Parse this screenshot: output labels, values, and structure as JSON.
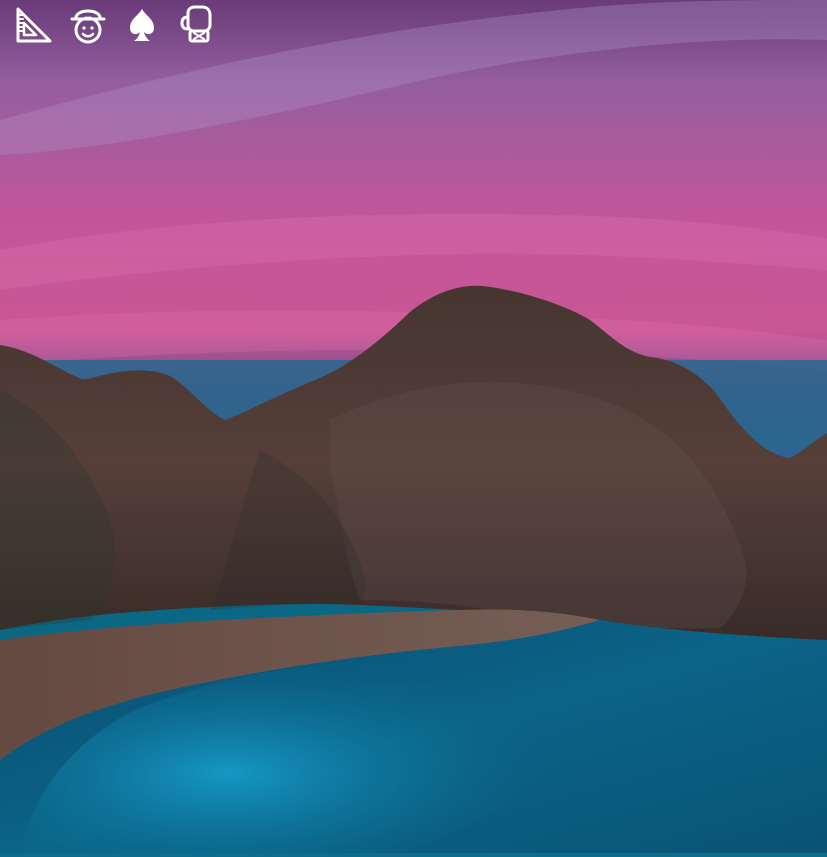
{
  "wallpaper": {
    "description_icon": "landscape-wallpaper"
  },
  "dock": {
    "items": [
      {
        "icon": "set-square-triangle-icon"
      },
      {
        "icon": "cowboy-face-icon"
      },
      {
        "icon": "spade-icon"
      },
      {
        "icon": "boxing-glove-icon"
      }
    ]
  },
  "colors": {
    "sky_top": "#6b3f7c",
    "sky_pink": "#d65fa5",
    "horizon_blue": "#2b6b94",
    "sea": "#0f6f93",
    "cliff": "#5a3a35",
    "beach": "#7a5a50",
    "icon": "#ffffff"
  }
}
